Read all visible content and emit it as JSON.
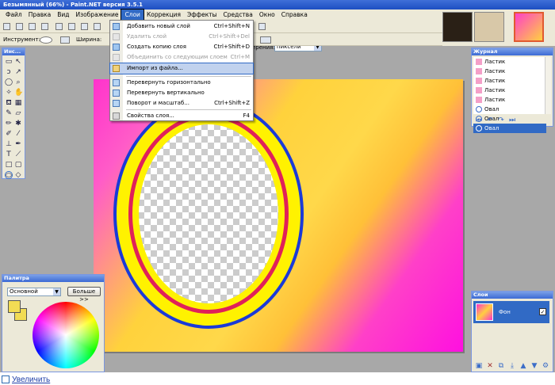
{
  "window": {
    "title": "Безымянный (66%) - Paint.NET версия 3.5.1"
  },
  "menubar": [
    "Файл",
    "Правка",
    "Вид",
    "Изображение",
    "Слои",
    "Коррекция",
    "Эффекты",
    "Средства",
    "Окно",
    "Справка"
  ],
  "toolbar": {
    "tool_label": "Инструмент:",
    "width_label": "Ширина:",
    "units_label": "ерения:",
    "units_value": "пиксели"
  },
  "layers_menu": {
    "items": [
      {
        "label": "Добавить новый слой",
        "shortcut": "Ctrl+Shift+N",
        "disabled": false
      },
      {
        "label": "Удалить слой",
        "shortcut": "Ctrl+Shift+Del",
        "disabled": true
      },
      {
        "label": "Создать копию слоя",
        "shortcut": "Ctrl+Shift+D",
        "disabled": false
      },
      {
        "label": "Объединить со следующим слоем",
        "shortcut": "Ctrl+M",
        "disabled": true
      },
      {
        "label": "Импорт из файла...",
        "shortcut": "",
        "disabled": false,
        "highlighted": true
      },
      {
        "label": "Перевернуть горизонтально",
        "shortcut": "",
        "disabled": false
      },
      {
        "label": "Перевернуть вертикально",
        "shortcut": "",
        "disabled": false
      },
      {
        "label": "Поворот и масштаб...",
        "shortcut": "Ctrl+Shift+Z",
        "disabled": false
      },
      {
        "label": "Свойства слоя...",
        "shortcut": "F4",
        "disabled": false
      }
    ]
  },
  "tools": {
    "title": "Инс..."
  },
  "history": {
    "title": "Журнал",
    "items": [
      "Ластик",
      "Ластик",
      "Ластик",
      "Ластик",
      "Ластик",
      "Овал",
      "Овал",
      "Овал"
    ],
    "selected_index": 7
  },
  "palette": {
    "title": "Палитра",
    "mode": "Основной",
    "more_button": "Больше >>",
    "primary_color": "#f2dc54",
    "secondary_color": "#f2dc54"
  },
  "layers": {
    "title": "Слои",
    "items": [
      {
        "name": "Фон",
        "visible": true
      }
    ]
  },
  "footer": {
    "enlarge_link": "Увеличить"
  },
  "colors": {
    "accent": "#316ac5",
    "ring_yellow": "#fff200",
    "ring_blue": "#1a3ad8",
    "ring_red": "#e0205a"
  }
}
